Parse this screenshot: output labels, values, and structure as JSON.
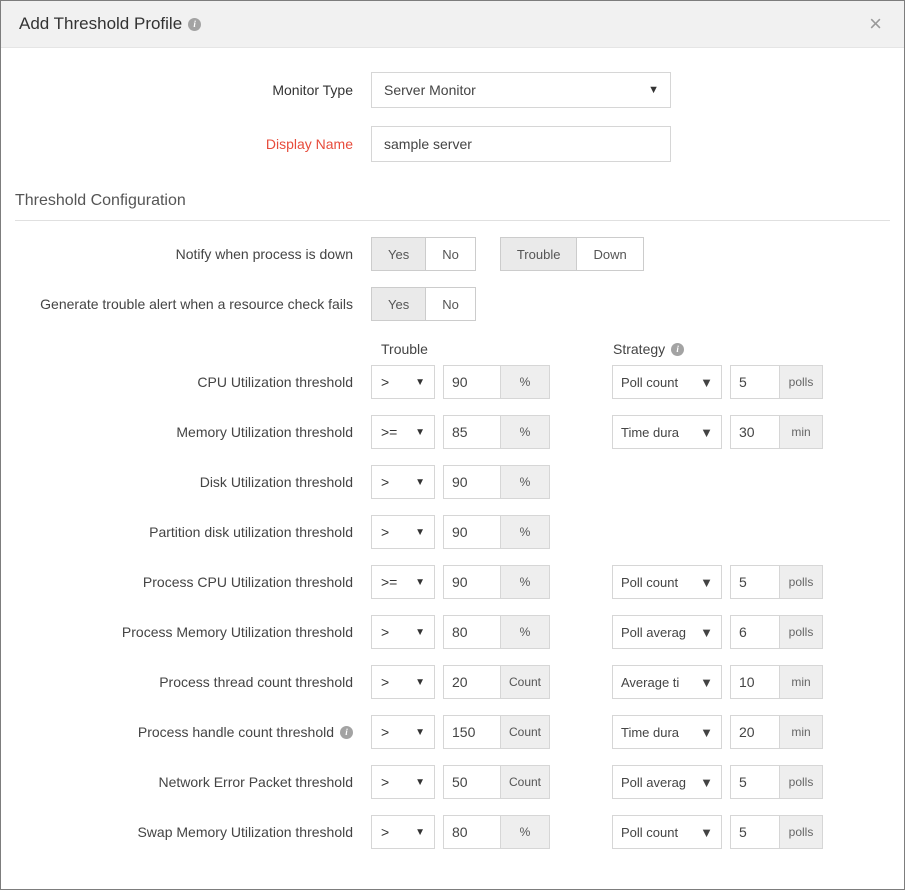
{
  "header": {
    "title": "Add Threshold Profile"
  },
  "form": {
    "monitor_type_label": "Monitor Type",
    "monitor_type_value": "Server Monitor",
    "display_name_label": "Display Name",
    "display_name_value": "sample server"
  },
  "section": {
    "threshold_config": "Threshold Configuration"
  },
  "toggles": {
    "notify_process_down_label": "Notify when process is down",
    "notify_yes": "Yes",
    "notify_no": "No",
    "notify_trouble": "Trouble",
    "notify_down": "Down",
    "resource_check_label": "Generate trouble alert when a resource check fails",
    "resource_yes": "Yes",
    "resource_no": "No"
  },
  "columns": {
    "trouble": "Trouble",
    "strategy": "Strategy"
  },
  "thresholds": [
    {
      "label": "CPU Utilization threshold",
      "info": false,
      "op": ">",
      "val": "90",
      "unit": "%",
      "strategy": "Poll count",
      "sval": "5",
      "sunit": "polls"
    },
    {
      "label": "Memory Utilization threshold",
      "info": false,
      "op": ">=",
      "val": "85",
      "unit": "%",
      "strategy": "Time duration",
      "sval": "30",
      "sunit": "min"
    },
    {
      "label": "Disk Utilization threshold",
      "info": false,
      "op": ">",
      "val": "90",
      "unit": "%",
      "strategy": null,
      "sval": null,
      "sunit": null
    },
    {
      "label": "Partition disk utilization threshold",
      "info": false,
      "op": ">",
      "val": "90",
      "unit": "%",
      "strategy": null,
      "sval": null,
      "sunit": null
    },
    {
      "label": "Process CPU Utilization threshold",
      "info": false,
      "op": ">=",
      "val": "90",
      "unit": "%",
      "strategy": "Poll count",
      "sval": "5",
      "sunit": "polls"
    },
    {
      "label": "Process Memory Utilization threshold",
      "info": false,
      "op": ">",
      "val": "80",
      "unit": "%",
      "strategy": "Poll average",
      "sval": "6",
      "sunit": "polls"
    },
    {
      "label": "Process thread count threshold",
      "info": false,
      "op": ">",
      "val": "20",
      "unit": "Count",
      "strategy": "Average time",
      "sval": "10",
      "sunit": "min"
    },
    {
      "label": "Process handle count threshold",
      "info": true,
      "op": ">",
      "val": "150",
      "unit": "Count",
      "strategy": "Time duration",
      "sval": "20",
      "sunit": "min"
    },
    {
      "label": "Network Error Packet threshold",
      "info": false,
      "op": ">",
      "val": "50",
      "unit": "Count",
      "strategy": "Poll average",
      "sval": "5",
      "sunit": "polls"
    },
    {
      "label": "Swap Memory Utilization threshold",
      "info": false,
      "op": ">",
      "val": "80",
      "unit": "%",
      "strategy": "Poll count",
      "sval": "5",
      "sunit": "polls"
    }
  ],
  "strategy_display": {
    "Poll count": "Poll count",
    "Time duration": "Time dura",
    "Poll average": "Poll averag",
    "Average time": "Average ti"
  }
}
